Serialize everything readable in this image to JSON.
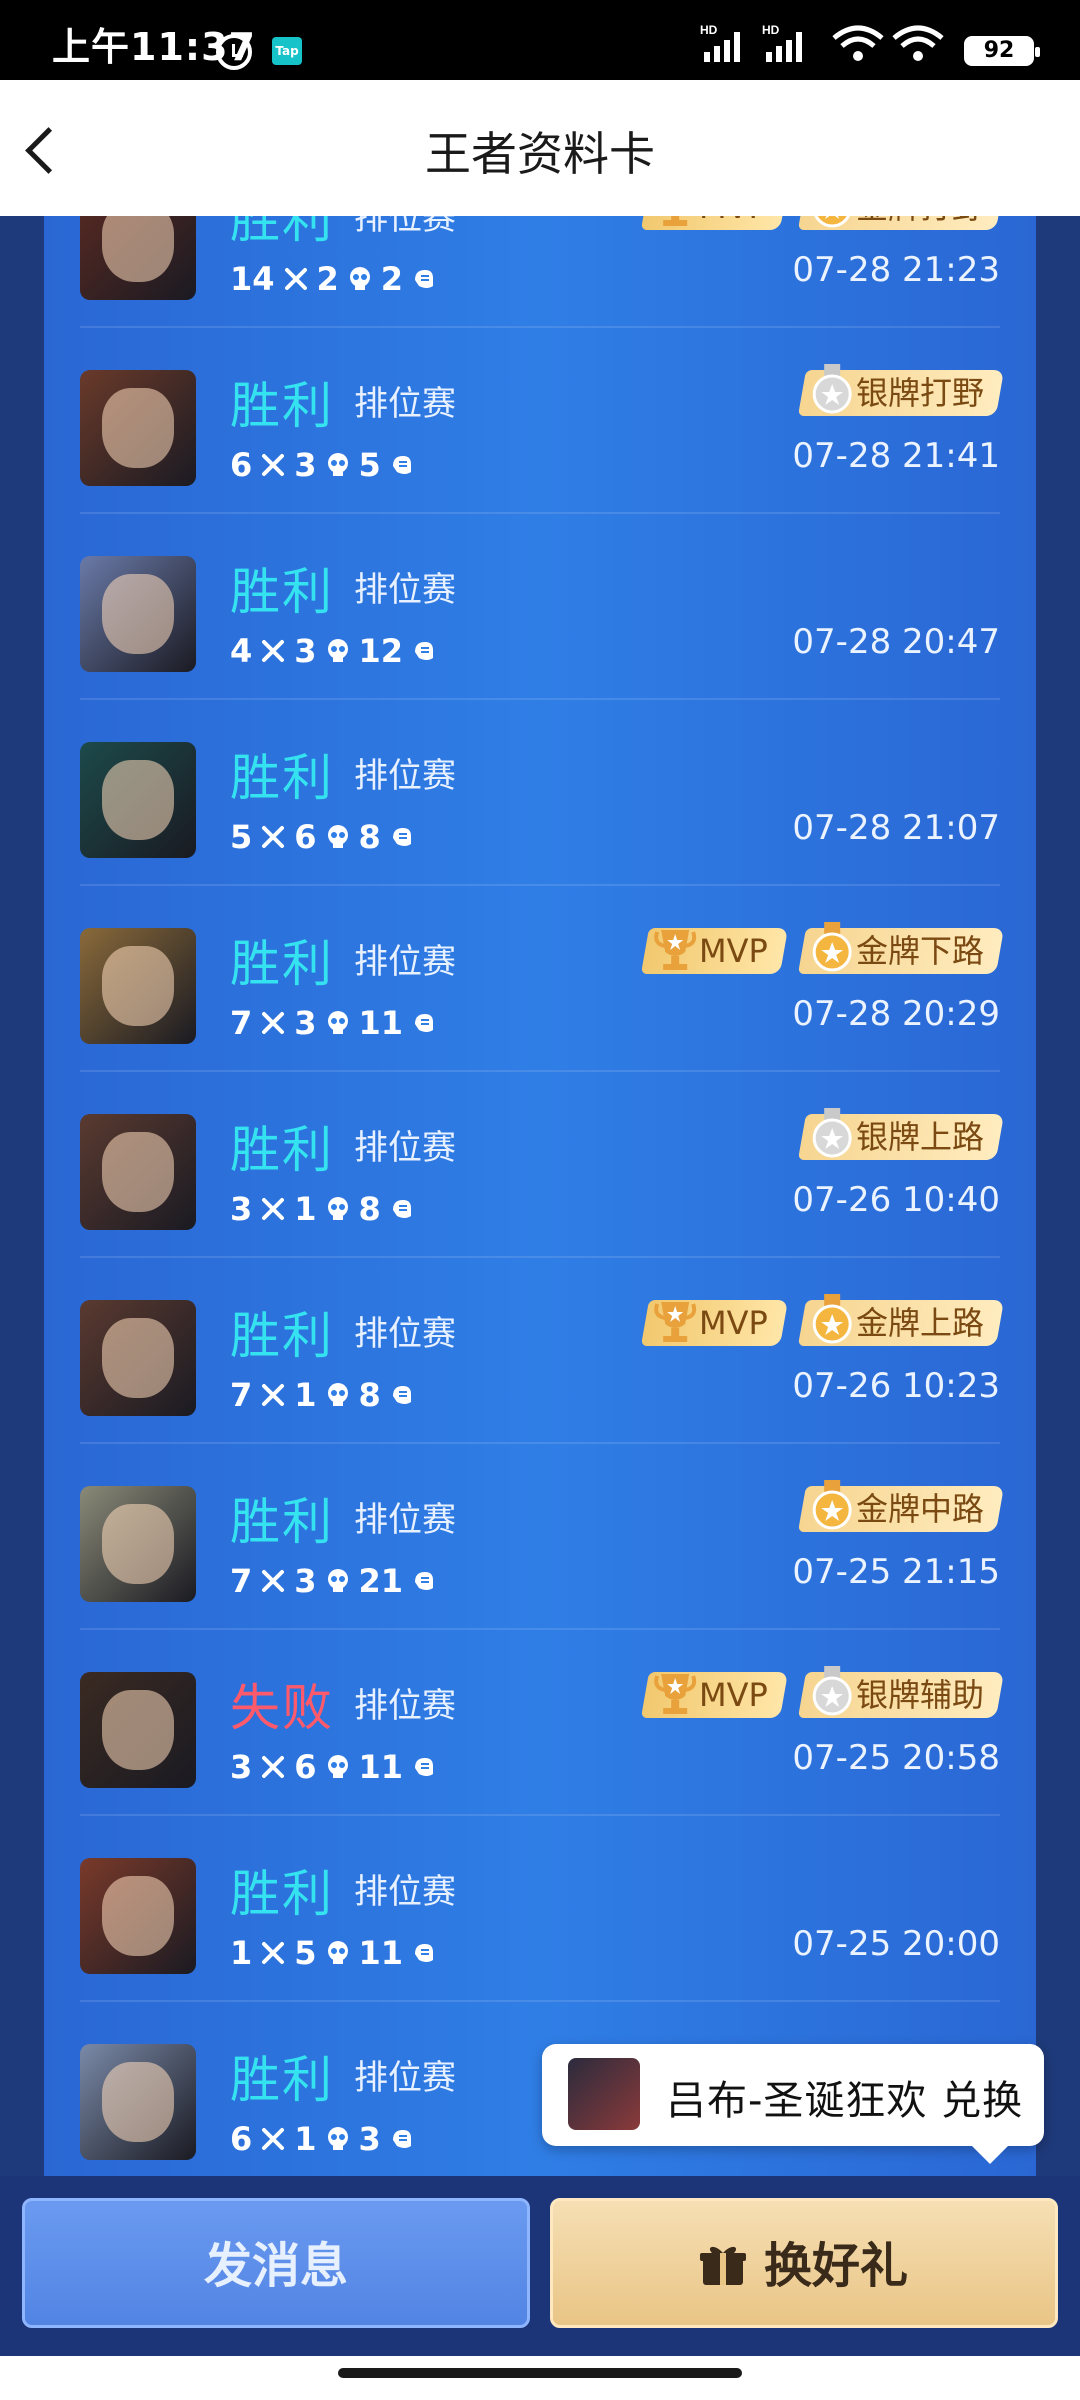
{
  "status_bar": {
    "time": "上午11:37",
    "battery": "92"
  },
  "header": {
    "title": "王者资料卡"
  },
  "matches": [
    {
      "result": "胜利",
      "outcome": "win",
      "mode": "排位赛",
      "kills": "14",
      "deaths": "2",
      "assists": "2",
      "time": "07-28 21:23",
      "badges": [
        "MVP",
        "金牌打野"
      ],
      "avatar_color": "#5a2a22"
    },
    {
      "result": "胜利",
      "outcome": "win",
      "mode": "排位赛",
      "kills": "6",
      "deaths": "3",
      "assists": "5",
      "time": "07-28 21:41",
      "badges": [
        "银牌打野"
      ],
      "avatar_color": "#6a3a2a"
    },
    {
      "result": "胜利",
      "outcome": "win",
      "mode": "排位赛",
      "kills": "4",
      "deaths": "3",
      "assists": "12",
      "time": "07-28 20:47",
      "badges": [],
      "avatar_color": "#6a7aa8"
    },
    {
      "result": "胜利",
      "outcome": "win",
      "mode": "排位赛",
      "kills": "5",
      "deaths": "6",
      "assists": "8",
      "time": "07-28 21:07",
      "badges": [],
      "avatar_color": "#1c4a4a"
    },
    {
      "result": "胜利",
      "outcome": "win",
      "mode": "排位赛",
      "kills": "7",
      "deaths": "3",
      "assists": "11",
      "time": "07-28 20:29",
      "badges": [
        "MVP",
        "金牌下路"
      ],
      "avatar_color": "#8a6a3a"
    },
    {
      "result": "胜利",
      "outcome": "win",
      "mode": "排位赛",
      "kills": "3",
      "deaths": "1",
      "assists": "8",
      "time": "07-26 10:40",
      "badges": [
        "银牌上路"
      ],
      "avatar_color": "#5a3a30"
    },
    {
      "result": "胜利",
      "outcome": "win",
      "mode": "排位赛",
      "kills": "7",
      "deaths": "1",
      "assists": "8",
      "time": "07-26 10:23",
      "badges": [
        "MVP",
        "金牌上路"
      ],
      "avatar_color": "#5a3a30"
    },
    {
      "result": "胜利",
      "outcome": "win",
      "mode": "排位赛",
      "kills": "7",
      "deaths": "3",
      "assists": "21",
      "time": "07-25 21:15",
      "badges": [
        "金牌中路"
      ],
      "avatar_color": "#8a8a78"
    },
    {
      "result": "失败",
      "outcome": "lose",
      "mode": "排位赛",
      "kills": "3",
      "deaths": "6",
      "assists": "11",
      "time": "07-25 20:58",
      "badges": [
        "MVP",
        "银牌辅助"
      ],
      "avatar_color": "#3a2a22"
    },
    {
      "result": "胜利",
      "outcome": "win",
      "mode": "排位赛",
      "kills": "1",
      "deaths": "5",
      "assists": "11",
      "time": "07-25 20:00",
      "badges": [],
      "avatar_color": "#7a3a2a"
    },
    {
      "result": "胜利",
      "outcome": "win",
      "mode": "排位赛",
      "kills": "6",
      "deaths": "1",
      "assists": "3",
      "time": "",
      "badges": [],
      "avatar_color": "#7a8aa8"
    }
  ],
  "toast": {
    "text": "吕布-圣诞狂欢 兑换"
  },
  "bottom_bar": {
    "message_label": "发消息",
    "gift_label": "换好礼"
  },
  "colors": {
    "win": "#35e3f0",
    "lose": "#ff5a6b",
    "panel": "#2f7ee6"
  }
}
